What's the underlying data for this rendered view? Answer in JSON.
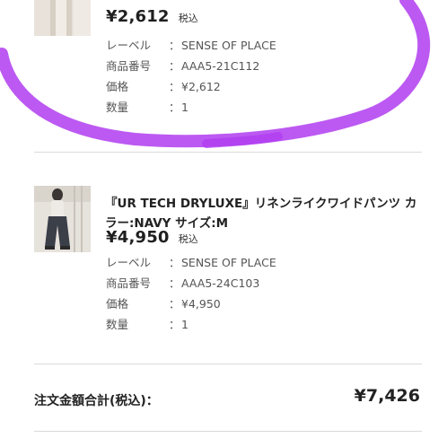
{
  "items": [
    {
      "price": "¥2,612",
      "tax_note": "税込",
      "details": [
        {
          "label": "レーベル",
          "sep": "：",
          "value": "SENSE OF PLACE"
        },
        {
          "label": "商品番号",
          "sep": "：",
          "value": "AAA5-21C112"
        },
        {
          "label": "価格",
          "sep": "：",
          "value": "¥2,612"
        },
        {
          "label": "数量",
          "sep": "：",
          "value": "1"
        }
      ]
    },
    {
      "title": "『UR TECH DRYLUXE』リネンライクワイドパンツ カラー:NAVY サイズ:M",
      "price": "¥4,950",
      "tax_note": "税込",
      "details": [
        {
          "label": "レーベル",
          "sep": "：",
          "value": "SENSE OF PLACE"
        },
        {
          "label": "商品番号",
          "sep": "：",
          "value": "AAA5-24C103"
        },
        {
          "label": "価格",
          "sep": "：",
          "value": "¥4,950"
        },
        {
          "label": "数量",
          "sep": "：",
          "value": "1"
        }
      ]
    }
  ],
  "total": {
    "label": "注文金額合計(税込)：",
    "value": "¥7,426"
  },
  "colors": {
    "annotation_stroke": "#b03cf0"
  }
}
